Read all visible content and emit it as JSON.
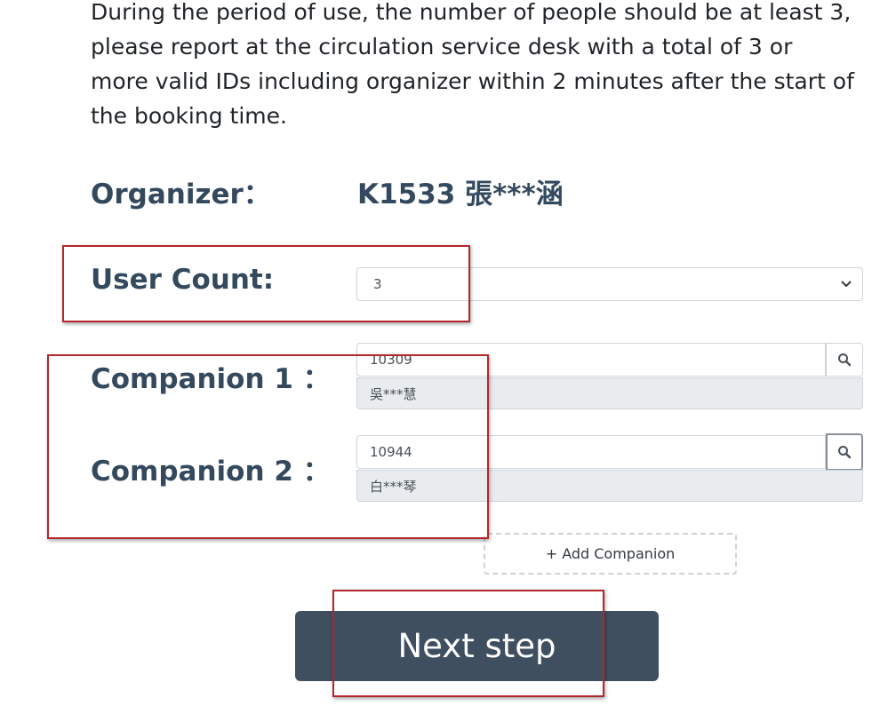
{
  "notice": "During the period of use, the number of people should be at least 3, please report at the circulation service desk with a total of 3 or more valid IDs including organizer within 2 minutes after the start of the booking time.",
  "organizer": {
    "label": "Organizer：",
    "value": "K1533 張***涵"
  },
  "user_count": {
    "label": "User Count:",
    "selected": "3"
  },
  "companions": [
    {
      "label": "Companion 1 ：",
      "id_value": "10309",
      "name": "吳***慧"
    },
    {
      "label": "Companion 2 ：",
      "id_value": "10944",
      "name": "白***琴"
    }
  ],
  "add_companion_label": "+ Add Companion",
  "next_step_label": "Next step",
  "colors": {
    "label": "#34495e",
    "button": "#3f4f60",
    "highlight": "#b3262b"
  },
  "icons": {
    "search": "search-icon",
    "select": "chevron-down-icon"
  }
}
